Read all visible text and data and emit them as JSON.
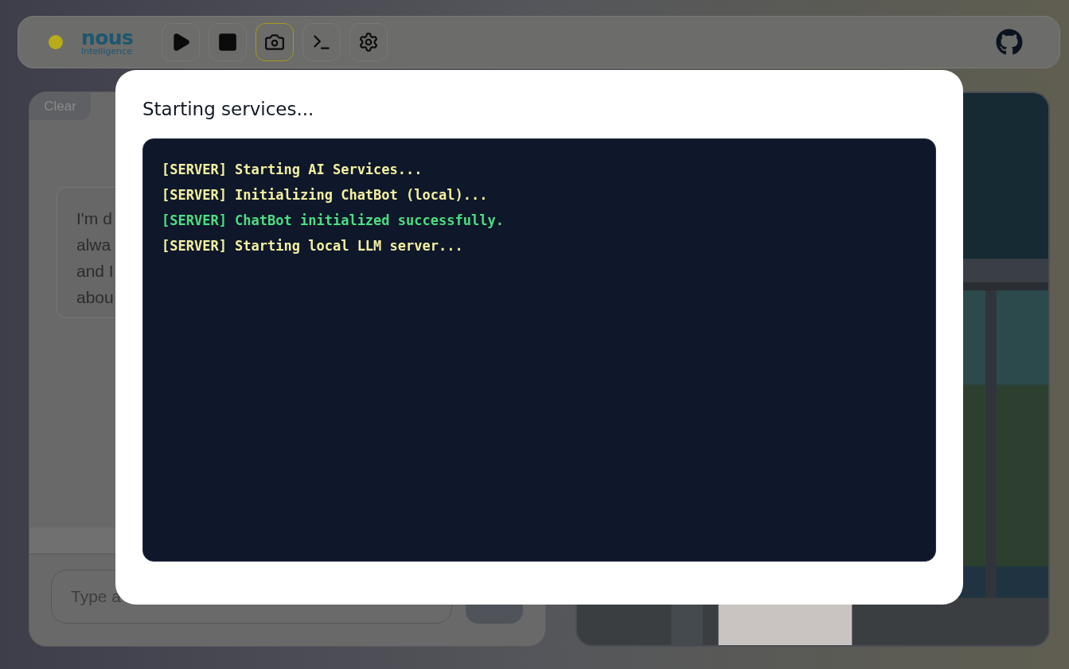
{
  "header": {
    "status_dot": {
      "color": "#b8ab1c"
    },
    "logo": {
      "name": "nous",
      "tagline": "Intelligence"
    },
    "toolbar": [
      {
        "kind": "play",
        "selected": false
      },
      {
        "kind": "stop",
        "selected": false
      },
      {
        "kind": "camera",
        "selected": true
      },
      {
        "kind": "terminal",
        "selected": false
      },
      {
        "kind": "settings",
        "selected": false
      }
    ]
  },
  "chat": {
    "clear_label": "Clear",
    "message_lines": [
      "I'm d",
      "alwa",
      "and I",
      "abou"
    ],
    "input": {
      "placeholder": "Type a"
    }
  },
  "dialog": {
    "title": "Starting services...",
    "log": [
      {
        "kind": "info",
        "text": "[SERVER] Starting AI Services..."
      },
      {
        "kind": "info",
        "text": "[SERVER] Initializing ChatBot (local)..."
      },
      {
        "kind": "success",
        "text": "[SERVER] ChatBot initialized successfully."
      },
      {
        "kind": "info",
        "text": "[SERVER] Starting local LLM server..."
      }
    ]
  }
}
